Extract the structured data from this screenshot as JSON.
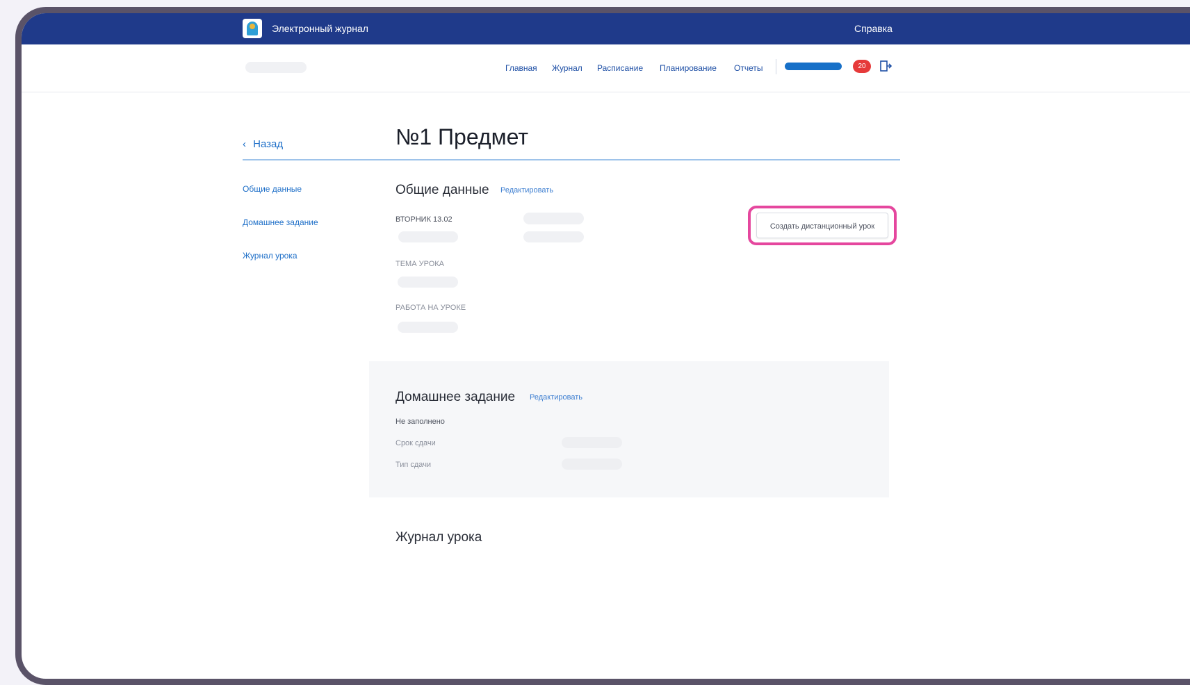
{
  "header": {
    "app_title": "Электронный журнал",
    "help_label": "Справка"
  },
  "nav": {
    "items": [
      "Главная",
      "Журнал",
      "Расписание",
      "Планирование",
      "Отчеты"
    ],
    "notification_count": "20",
    "accent_color": "#1770c8"
  },
  "page": {
    "back_label": "Назад",
    "title": "№1 Предмет"
  },
  "sidebar": {
    "items": [
      {
        "label": "Общие данные"
      },
      {
        "label": "Домашнее задание"
      },
      {
        "label": "Журнал урока"
      }
    ]
  },
  "general": {
    "title": "Общие данные",
    "edit_label": "Редактировать",
    "date_label": "ВТОРНИК 13.02",
    "topic_label": "ТЕМА УРОКА",
    "work_label": "РАБОТА НА УРОКЕ",
    "remote_button_label": "Создать дистанционный урок",
    "highlight_color": "#e5479e"
  },
  "homework": {
    "title": "Домашнее задание",
    "edit_label": "Редактировать",
    "status": "Не заполнено",
    "deadline_label": "Срок сдачи",
    "type_label": "Тип сдачи"
  },
  "lesson_log": {
    "title": "Журнал урока"
  },
  "icons": {
    "logo": "app-logo-icon",
    "back": "chevron-left-icon",
    "logout": "logout-icon"
  }
}
